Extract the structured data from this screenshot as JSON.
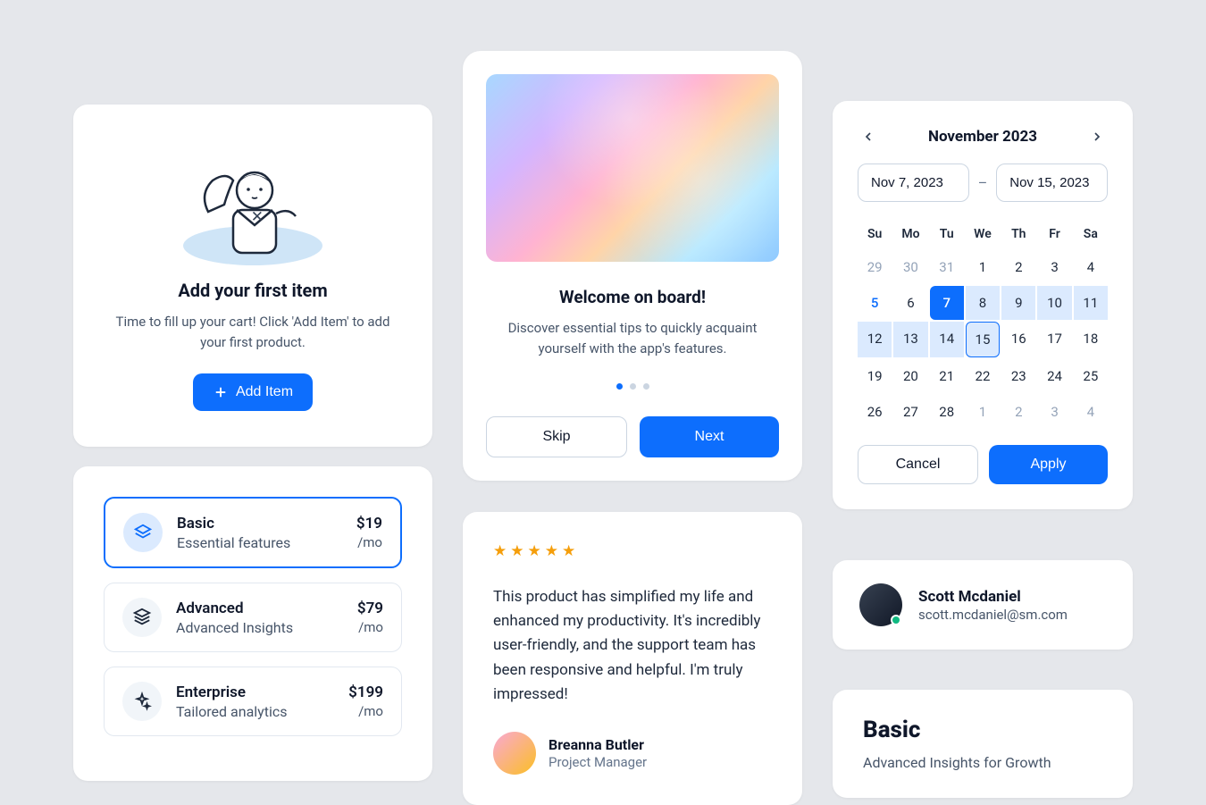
{
  "empty_state": {
    "title": "Add your first item",
    "description": "Time to fill up your cart! Click 'Add Item' to add your first product.",
    "button": "Add Item",
    "close_glyph": "✕"
  },
  "welcome": {
    "title": "Welcome on board!",
    "description": "Discover essential tips to quickly acquaint yourself with the app's features.",
    "skip": "Skip",
    "next": "Next"
  },
  "pricing": [
    {
      "name": "Basic",
      "subtitle": "Essential features",
      "price": "$19",
      "period": "/mo",
      "selected": true
    },
    {
      "name": "Advanced",
      "subtitle": "Advanced Insights",
      "price": "$79",
      "period": "/mo",
      "selected": false
    },
    {
      "name": "Enterprise",
      "subtitle": "Tailored analytics",
      "price": "$199",
      "period": "/mo",
      "selected": false
    }
  ],
  "testimonial": {
    "rating": 5,
    "text": "This product has simplified my life and enhanced my productivity. It's incredibly user-friendly, and the support team has been responsive and helpful. I'm truly impressed!",
    "author_name": "Breanna Butler",
    "author_role": "Project Manager"
  },
  "calendar": {
    "month_label": "November 2023",
    "from_date": "Nov 7, 2023",
    "to_date": "Nov 15, 2023",
    "dash": "–",
    "dow": [
      "Su",
      "Mo",
      "Tu",
      "We",
      "Th",
      "Fr",
      "Sa"
    ],
    "days_prev": [
      29,
      30,
      31
    ],
    "days_this": [
      1,
      2,
      3,
      4,
      5,
      6,
      7,
      8,
      9,
      10,
      11,
      12,
      13,
      14,
      15,
      16,
      17,
      18,
      19,
      20,
      21,
      22,
      23,
      24,
      25,
      26,
      27,
      28
    ],
    "days_next": [
      1,
      2,
      3,
      4
    ],
    "range_start": 7,
    "range_end": 15,
    "link_day": 5,
    "cancel": "Cancel",
    "apply": "Apply"
  },
  "user": {
    "name": "Scott Mcdaniel",
    "email": "scott.mcdaniel@sm.com"
  },
  "basic_card": {
    "title": "Basic",
    "subtitle": "Advanced Insights for Growth"
  }
}
